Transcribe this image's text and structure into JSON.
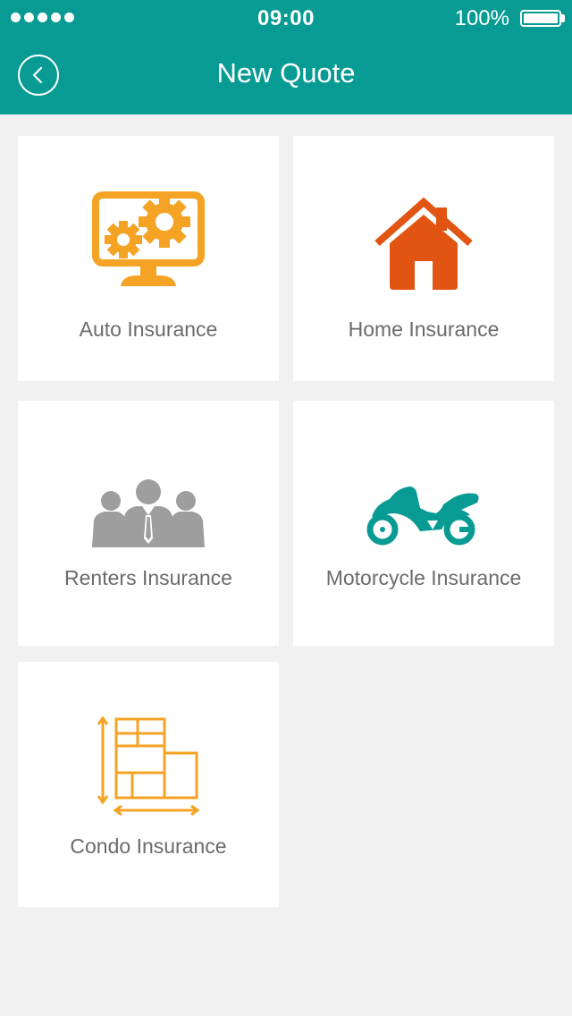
{
  "status_bar": {
    "time": "09:00",
    "battery": "100%"
  },
  "header": {
    "title": "New Quote",
    "back_icon": "chevron-left-icon"
  },
  "colors": {
    "header": "#079b94",
    "background": "#f1f1f1",
    "auto_icon": "#f5a324",
    "home_icon": "#e25412",
    "renters_icon": "#9e9e9e",
    "motorcycle_icon": "#079b94",
    "condo_icon": "#f5a324"
  },
  "cards": [
    {
      "label": "Auto Insurance",
      "icon": "monitor-gears-icon"
    },
    {
      "label": "Home Insurance",
      "icon": "house-icon"
    },
    {
      "label": "Renters Insurance",
      "icon": "people-icon"
    },
    {
      "label": "Motorcycle Insurance",
      "icon": "motorcycle-icon"
    },
    {
      "label": "Condo Insurance",
      "icon": "floor-plan-icon"
    }
  ]
}
